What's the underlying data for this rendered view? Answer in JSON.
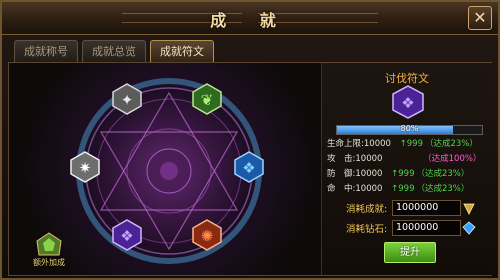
{
  "window": {
    "title": "成 就",
    "close_label": "✕"
  },
  "tabs": [
    {
      "label": "成就称号",
      "active": false
    },
    {
      "label": "成就总览",
      "active": false
    },
    {
      "label": "成就符文",
      "active": true
    }
  ],
  "circle": {
    "gems": [
      {
        "name": "gray-rune-gem",
        "color": "#9a9a9a",
        "symbol": "✦"
      },
      {
        "name": "green-rune-gem",
        "color": "#5aa83a",
        "symbol": "❦"
      },
      {
        "name": "silver-rune-gem",
        "color": "#bdbdbd",
        "symbol": "✷"
      },
      {
        "name": "blue-rune-gem",
        "color": "#2f8fe0",
        "symbol": "❖"
      },
      {
        "name": "purple-rune-gem",
        "color": "#8d4fe0",
        "symbol": "❖"
      },
      {
        "name": "orange-rune-gem",
        "color": "#e05a1f",
        "symbol": "✺"
      }
    ],
    "extra_bonus_label": "额外加成"
  },
  "info": {
    "title": "讨伐符文",
    "progress": {
      "percent": 80,
      "label": "80%"
    },
    "attributes": [
      {
        "name": "生命上限",
        "value": ":10000",
        "increase": "999",
        "achieve": "（达成23%）",
        "achieve_color": "green",
        "has_increase": true
      },
      {
        "name": "攻　击",
        "value": ":10000",
        "increase": "",
        "achieve": "（达成100%）",
        "achieve_color": "pink",
        "has_increase": false
      },
      {
        "name": "防　御",
        "value": ":10000",
        "increase": "999",
        "achieve": "（达成23%）",
        "achieve_color": "green",
        "has_increase": true
      },
      {
        "name": "命　中",
        "value": ":10000",
        "increase": "999",
        "achieve": "（达成23%）",
        "achieve_color": "green",
        "has_increase": true
      }
    ],
    "costs": [
      {
        "label": "消耗成就:",
        "value": "1000000",
        "icon": "achievement-icon"
      },
      {
        "label": "消耗钻石:",
        "value": "1000000",
        "icon": "diamond-icon"
      }
    ],
    "upgrade_label": "提升"
  },
  "colors": {
    "gold": "#f2b244",
    "green": "#4fd24a",
    "pink": "#ff5cd2",
    "accent_blue": "#2e7fd8"
  }
}
